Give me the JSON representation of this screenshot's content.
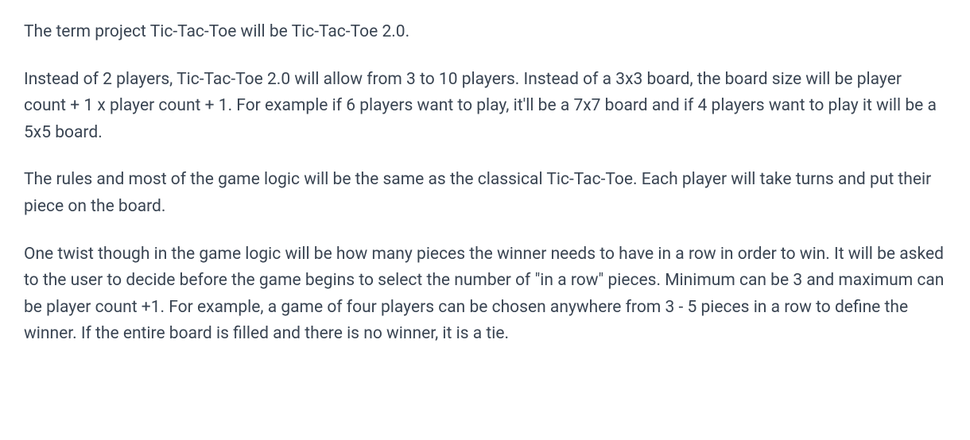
{
  "paragraphs": {
    "p1": "The term project Tic-Tac-Toe will be Tic-Tac-Toe 2.0.",
    "p2": "Instead of 2 players, Tic-Tac-Toe 2.0 will allow from 3 to 10 players. Instead of a 3x3 board, the board size will be player count + 1 x player count + 1. For example if 6 players want to play, it'll be a 7x7 board and if 4 players want to play it will be a 5x5 board.",
    "p3": "The rules and most of the game logic will be the same as the classical Tic-Tac-Toe. Each player will take turns and put their piece on the board.",
    "p4": "One twist though in the game logic will be how many pieces the winner needs to have in a row in order to win. It will be asked to the user to decide before the game begins to select the number of \"in a row\" pieces. Minimum can be 3 and maximum can be player count +1. For example, a game of four players can be chosen anywhere from 3 - 5 pieces in a row to define the winner. If the entire board is filled and there is no winner, it is a tie."
  }
}
